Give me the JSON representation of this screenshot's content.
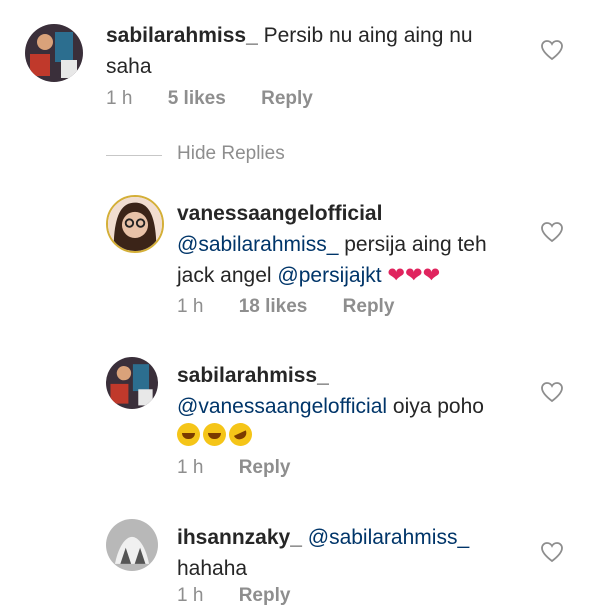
{
  "comments": [
    {
      "username": "sabilarahmiss_",
      "text_line1": "Persib nu aing aing nu",
      "text_line2": "saha",
      "time": "1 h",
      "likes": "5 likes",
      "reply": "Reply"
    }
  ],
  "hide_replies": "Hide Replies",
  "replies": [
    {
      "username": "vanessaangelofficial",
      "mention": "@sabilarahmiss_",
      "text_a": " persija aing teh",
      "text_b": "jack angel ",
      "mention2": "@persijajkt",
      "hearts": " ❤❤❤",
      "time": "1 h",
      "likes": "18 likes",
      "reply": "Reply"
    },
    {
      "username": "sabilarahmiss_",
      "mention": "@vanessaangelofficial",
      "text_a": " oiya poho",
      "emoji_names": [
        "laughing-emoji",
        "laughing-emoji",
        "rolling-laughing-emoji"
      ],
      "time": "1 h",
      "reply": "Reply"
    },
    {
      "username": "ihsannzaky_",
      "mention": "@sabilarahmiss_",
      "text_b": "hahaha",
      "time": "1 h",
      "reply": "Reply"
    }
  ],
  "icons": {
    "like": "heart-outline-icon"
  }
}
